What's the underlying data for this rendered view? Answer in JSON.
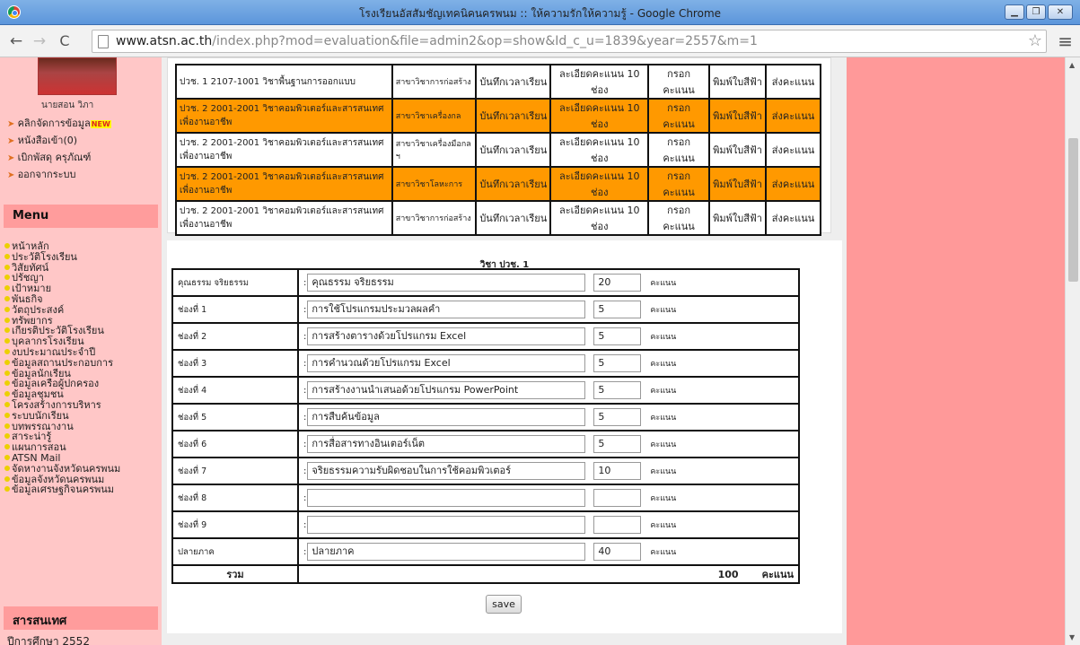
{
  "window": {
    "title": "โรงเรียนอัสสัมชัญเทคนิคนครพนม :: ให้ความรักให้ความรู้ - Google Chrome"
  },
  "browser": {
    "url_host": "www.atsn.ac.th",
    "url_path": "/index.php?mod=evaluation&file=admin2&op=show&Id_c_u=1839&year=2557&m=1"
  },
  "sidebar": {
    "user_name": "นายสอน วิภา",
    "user_menu": [
      {
        "label": "คลิกจัดการข้อมูล",
        "badge": "NEW"
      },
      {
        "label": "หนังสือเข้า(0)"
      },
      {
        "label": "เบิกพัสดุ ครุภัณฑ์"
      },
      {
        "label": "ออกจากระบบ"
      }
    ],
    "menu_title": "Menu",
    "menu_items": [
      "หน้าหลัก",
      "ประวัติโรงเรียน",
      "วิสัยทัศน์",
      "ปรัชญา",
      "เป้าหมาย",
      "พันธกิจ",
      "วัตถุประสงค์",
      "ทรัพยากร",
      "เกียรติประวัติโรงเรียน",
      "บุคลากรโรงเรียน",
      "งบประมาณประจำปี",
      "ข้อมูลสถานประกอบการ",
      "ข้อมูลนักเรียน",
      "ข้อมูลเครือผู้ปกครอง",
      "ข้อมูลชุมชน",
      "โครงสร้างการบริหาร",
      "ระบบนักเรียน",
      "บทพรรณางาน",
      "สาระน่ารู้",
      "แผนการสอน",
      "ATSN Mail",
      "จัดหางานจังหวัดนครพนม",
      "ข้อมูลจังหวัดนครพนม",
      "ข้อมูลเศรษฐกิจนครพนม"
    ],
    "info_title": "สารสนเทศ",
    "info_line": "ปีการศึกษา 2552"
  },
  "subjects": [
    {
      "course": "ปวช. 1 2107-1001 วิชาพื้นฐานการออกแบบ",
      "dept": "สาขาวิชาการก่อสร้าง",
      "time": "บันทึกเวลาเรียน",
      "detail": "ละเอียดคะแนน 10 ช่อง",
      "fill": "กรอกคะแนน",
      "print": "พิมพ์ใบสีฟ้า",
      "send": "ส่งคะแนน",
      "hl": false
    },
    {
      "course": "ปวช. 2 2001-2001 วิชาคอมพิวเตอร์และสารสนเทศเพื่องานอาชีพ",
      "dept": "สาขาวิชาเครื่องกล",
      "time": "บันทึกเวลาเรียน",
      "detail": "ละเอียดคะแนน 10 ช่อง",
      "fill": "กรอกคะแนน",
      "print": "พิมพ์ใบสีฟ้า",
      "send": "ส่งคะแนน",
      "hl": true
    },
    {
      "course": "ปวช. 2 2001-2001 วิชาคอมพิวเตอร์และสารสนเทศเพื่องานอาชีพ",
      "dept": "สาขาวิชาเครื่องมือกล ฯ",
      "time": "บันทึกเวลาเรียน",
      "detail": "ละเอียดคะแนน 10 ช่อง",
      "fill": "กรอกคะแนน",
      "print": "พิมพ์ใบสีฟ้า",
      "send": "ส่งคะแนน",
      "hl": false
    },
    {
      "course": "ปวช. 2 2001-2001 วิชาคอมพิวเตอร์และสารสนเทศเพื่องานอาชีพ",
      "dept": "สาขาวิชาโลหะการ",
      "time": "บันทึกเวลาเรียน",
      "detail": "ละเอียดคะแนน 10 ช่อง",
      "fill": "กรอกคะแนน",
      "print": "พิมพ์ใบสีฟ้า",
      "send": "ส่งคะแนน",
      "hl": true
    },
    {
      "course": "ปวช. 2 2001-2001 วิชาคอมพิวเตอร์และสารสนเทศเพื่องานอาชีพ",
      "dept": "สาขาวิชาการก่อสร้าง",
      "time": "บันทึกเวลาเรียน",
      "detail": "ละเอียดคะแนน 10 ช่อง",
      "fill": "กรอกคะแนน",
      "print": "พิมพ์ใบสีฟ้า",
      "send": "ส่งคะแนน",
      "hl": false
    }
  ],
  "form": {
    "title": "วิชา ปวช. 1",
    "unit": "คะแนน",
    "rows": [
      {
        "label": "คุณธรรม จริยธรรม",
        "name": "คุณธรรม จริยธรรม",
        "points": "20"
      },
      {
        "label": "ช่องที่ 1",
        "name": "การใช้โปรแกรมประมวลผลคำ",
        "points": "5"
      },
      {
        "label": "ช่องที่ 2",
        "name": "การสร้างตารางด้วยโปรแกรม Excel",
        "points": "5"
      },
      {
        "label": "ช่องที่ 3",
        "name": "การคำนวณด้วยโปรแกรม Excel",
        "points": "5"
      },
      {
        "label": "ช่องที่ 4",
        "name": "การสร้างงานนำเสนอด้วยโปรแกรม PowerPoint",
        "points": "5"
      },
      {
        "label": "ช่องที่ 5",
        "name": "การสืบค้นข้อมูล",
        "points": "5"
      },
      {
        "label": "ช่องที่ 6",
        "name": "การสื่อสารทางอินเตอร์เน็ต",
        "points": "5"
      },
      {
        "label": "ช่องที่ 7",
        "name": "จริยธรรมความรับผิดชอบในการใช้คอมพิวเตอร์",
        "points": "10"
      },
      {
        "label": "ช่องที่ 8",
        "name": "",
        "points": ""
      },
      {
        "label": "ช่องที่ 9",
        "name": "",
        "points": ""
      },
      {
        "label": "ปลายภาค",
        "name": "ปลายภาค",
        "points": "40"
      }
    ],
    "total_label": "รวม",
    "total_value": "100",
    "total_unit": "คะแนน",
    "save_label": "save"
  }
}
